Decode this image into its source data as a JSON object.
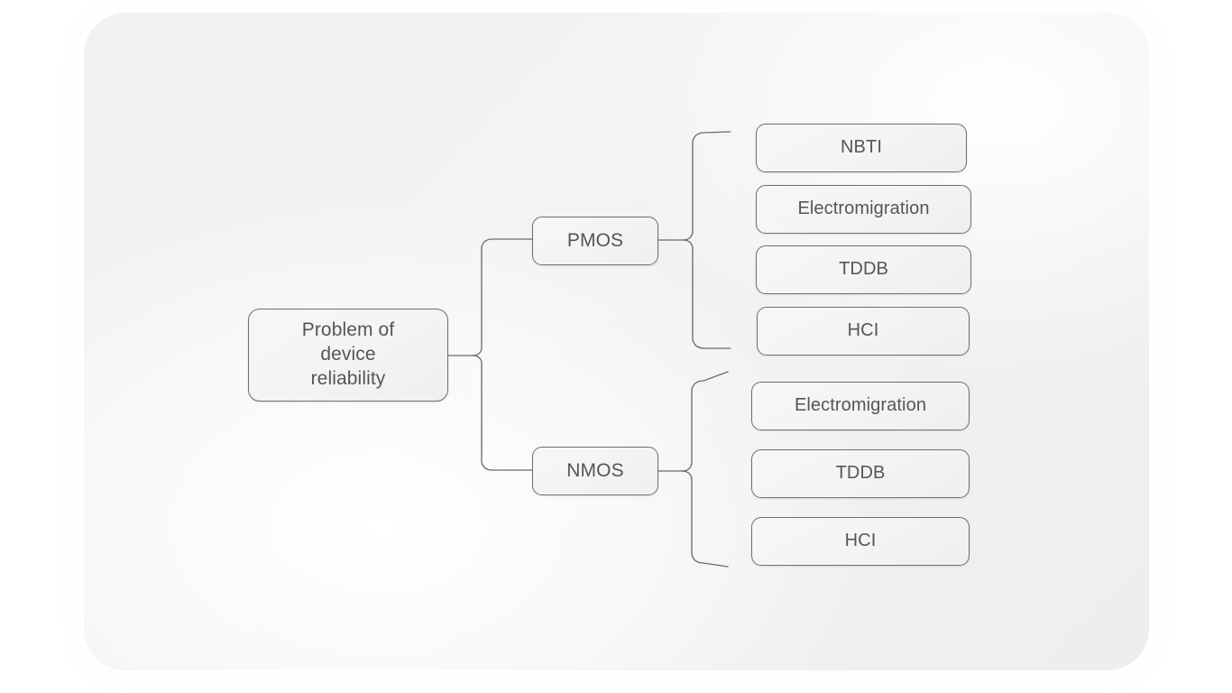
{
  "diagram": {
    "type": "tree",
    "title": "Problem of device reliability",
    "root": {
      "id": "root",
      "label": "Problem of\ndevice\nreliability"
    },
    "branches": [
      {
        "id": "pmos",
        "label": "PMOS",
        "leaves": [
          {
            "id": "pmos-nbti",
            "label": "NBTI"
          },
          {
            "id": "pmos-electromigration",
            "label": "Electromigration"
          },
          {
            "id": "pmos-tddb",
            "label": "TDDB"
          },
          {
            "id": "pmos-hci",
            "label": "HCI"
          }
        ]
      },
      {
        "id": "nmos",
        "label": "NMOS",
        "leaves": [
          {
            "id": "nmos-electromigration",
            "label": "Electromigration"
          },
          {
            "id": "nmos-tddb",
            "label": "TDDB"
          },
          {
            "id": "nmos-hci",
            "label": "HCI"
          }
        ]
      }
    ],
    "style": {
      "node_border_color": "#6f6f6f",
      "node_text_color": "#555555",
      "node_fill_color": "#f4f4f2",
      "panel_background_color": "#f2f2f0",
      "page_background_color": "#ffffff",
      "connector_color": "#6b6b6b",
      "connector_style": "curly-brace"
    }
  }
}
